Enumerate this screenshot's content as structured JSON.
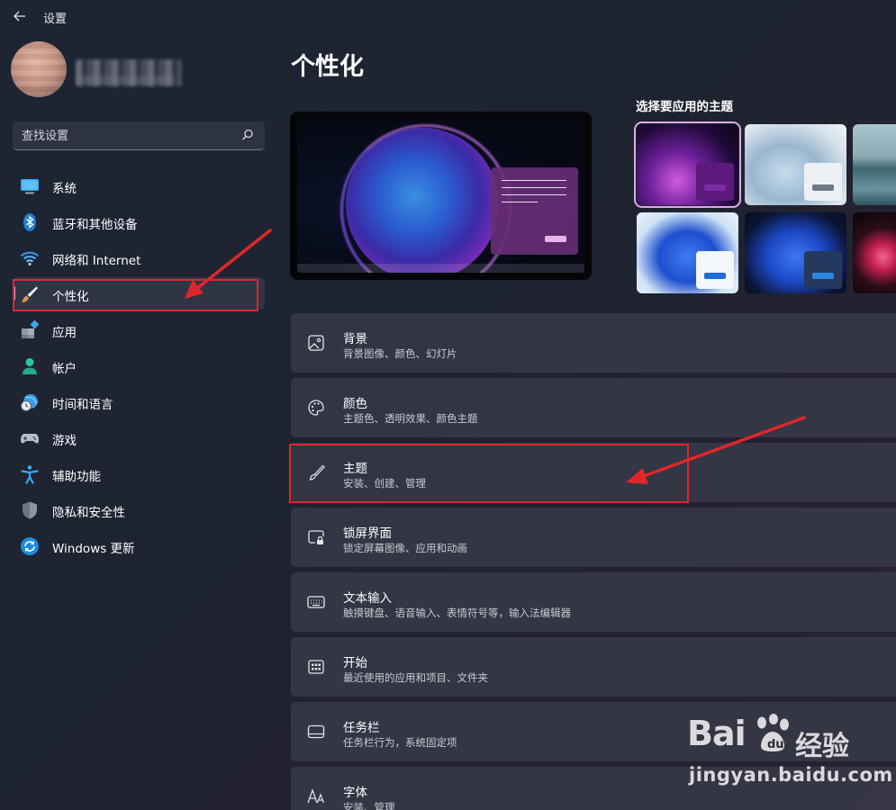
{
  "window": {
    "title": "设置"
  },
  "search": {
    "placeholder": "查找设置"
  },
  "sidebar": {
    "items": [
      {
        "label": "系统",
        "icon": "monitor-icon"
      },
      {
        "label": "蓝牙和其他设备",
        "icon": "bluetooth-icon"
      },
      {
        "label": "网络和 Internet",
        "icon": "wifi-icon"
      },
      {
        "label": "个性化",
        "icon": "paintbrush-icon",
        "selected": true
      },
      {
        "label": "应用",
        "icon": "apps-icon"
      },
      {
        "label": "帐户",
        "icon": "person-icon"
      },
      {
        "label": "时间和语言",
        "icon": "globe-clock-icon"
      },
      {
        "label": "游戏",
        "icon": "gamepad-icon"
      },
      {
        "label": "辅助功能",
        "icon": "accessibility-icon"
      },
      {
        "label": "隐私和安全性",
        "icon": "shield-icon"
      },
      {
        "label": "Windows 更新",
        "icon": "update-icon"
      }
    ]
  },
  "main": {
    "title": "个性化",
    "themes_label": "选择要应用的主题",
    "cards": [
      {
        "title": "背景",
        "subtitle": "背景图像、颜色、幻灯片",
        "icon": "image-icon"
      },
      {
        "title": "颜色",
        "subtitle": "主题色、透明效果、颜色主题",
        "icon": "palette-icon"
      },
      {
        "title": "主题",
        "subtitle": "安装、创建、管理",
        "icon": "brush-icon"
      },
      {
        "title": "锁屏界面",
        "subtitle": "锁定屏幕图像、应用和动画",
        "icon": "lock-screen-icon"
      },
      {
        "title": "文本输入",
        "subtitle": "触摸键盘、语音输入、表情符号等，输入法编辑器",
        "icon": "keyboard-icon"
      },
      {
        "title": "开始",
        "subtitle": "最近使用的应用和项目、文件夹",
        "icon": "start-grid-icon"
      },
      {
        "title": "任务栏",
        "subtitle": "任务栏行为，系统固定项",
        "icon": "taskbar-icon"
      },
      {
        "title": "字体",
        "subtitle": "安装、管理",
        "icon": "font-icon"
      }
    ]
  },
  "watermark": {
    "brand": "Bai",
    "brand_cn": "经验",
    "url": "jingyan.baidu.com"
  },
  "colors": {
    "accent": "#dca9e5",
    "annotation": "#e0262a"
  }
}
